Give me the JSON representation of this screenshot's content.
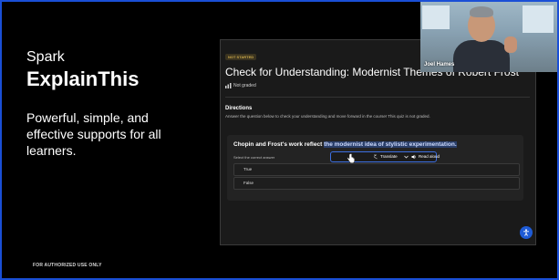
{
  "slide": {
    "title": "Spark",
    "brand": "ExplainThis",
    "description": "Powerful, simple, and effective supports for all learners.",
    "footer": "FOR AUTHORIZED USE ONLY"
  },
  "screen": {
    "status_badge": "NOT STARTED",
    "quiz_title": "Check for Understanding: Modernist Themes of Robert Frost",
    "grading": "Not graded",
    "directions_heading": "Directions",
    "directions_text": "Answer the question below to check your understanding and move forward in the course! This quiz is not graded.",
    "question_prefix": "Chopin and Frost's work reflect ",
    "question_highlight": "the modernist idea of stylistic experimentation.",
    "answer_label": "Select the correct answer",
    "options": [
      "True",
      "False"
    ],
    "toolbar": {
      "translate_label": "Translate",
      "read_aloud_label": "Read aloud"
    }
  },
  "webcam": {
    "name": "Joel Hames"
  },
  "colors": {
    "frame_border": "#1a4fd6",
    "highlight": "#2a3f6a",
    "toolbar_border": "#3d6fe0",
    "help_button": "#1e5bd6"
  },
  "icons": [
    "bar-chart-icon",
    "translate-icon",
    "chevron-down-icon",
    "speaker-icon",
    "pointer-cursor-icon",
    "accessibility-icon"
  ]
}
